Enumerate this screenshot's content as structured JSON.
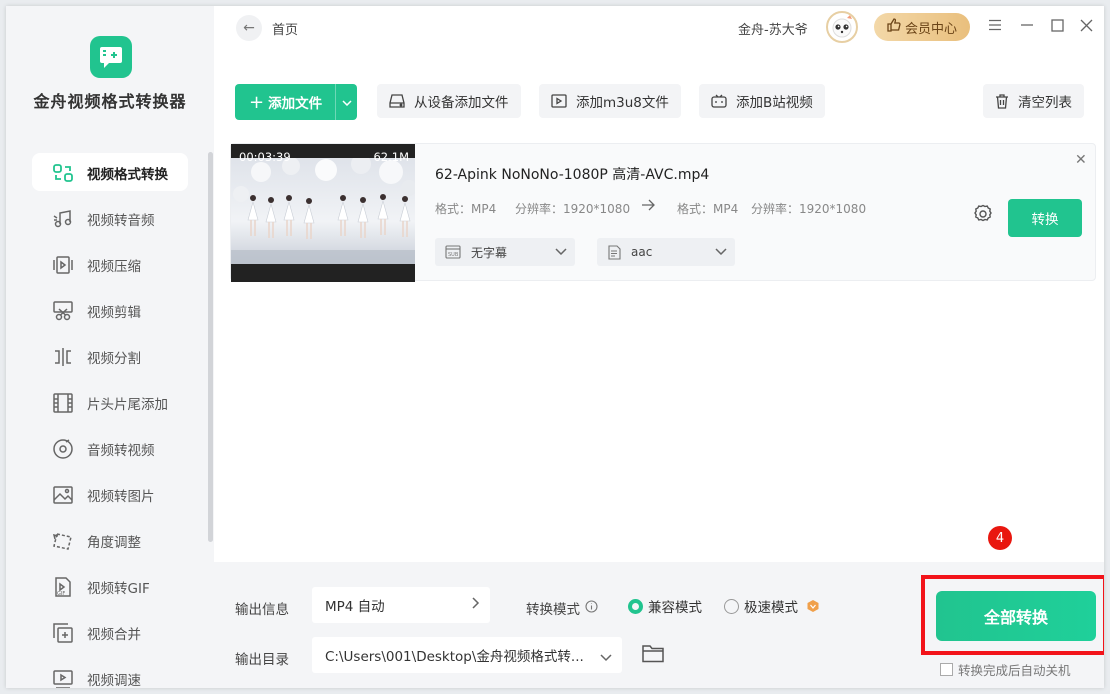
{
  "app": {
    "title": "金舟视频格式转换器"
  },
  "sidebar": {
    "items": [
      {
        "label": "视频格式转换",
        "icon": "format-convert-icon",
        "active": true
      },
      {
        "label": "视频转音频",
        "icon": "music-note-icon"
      },
      {
        "label": "视频压缩",
        "icon": "compress-icon"
      },
      {
        "label": "视频剪辑",
        "icon": "scissors-icon"
      },
      {
        "label": "视频分割",
        "icon": "split-icon"
      },
      {
        "label": "片头片尾添加",
        "icon": "film-strip-icon"
      },
      {
        "label": "音频转视频",
        "icon": "disc-icon"
      },
      {
        "label": "视频转图片",
        "icon": "image-icon"
      },
      {
        "label": "角度调整",
        "icon": "rotate-icon"
      },
      {
        "label": "视频转GIF",
        "icon": "gif-icon"
      },
      {
        "label": "视频合并",
        "icon": "merge-icon"
      },
      {
        "label": "视频调速",
        "icon": "speed-icon"
      }
    ]
  },
  "header": {
    "breadcrumb": "首页",
    "user_name": "金舟-苏大爷",
    "vip_label": "会员中心"
  },
  "toolbar": {
    "add_file": "添加文件",
    "add_from_device": "从设备添加文件",
    "add_m3u8": "添加m3u8文件",
    "add_bilibili": "添加B站视频",
    "clear_list": "清空列表"
  },
  "file": {
    "name": "62-Apink NoNoNo-1080P 高清-AVC.mp4",
    "duration": "00:03:39",
    "size": "62.1M",
    "src_format": "格式：MP4",
    "src_resolution": "分辨率：1920*1080",
    "dst_format": "格式：MP4",
    "dst_resolution": "分辨率：1920*1080",
    "subtitle": "无字幕",
    "audio": "aac",
    "convert_label": "转换"
  },
  "bottom": {
    "output_info_label": "输出信息",
    "output_info_value": "MP4 自动",
    "output_dir_label": "输出目录",
    "output_dir_value": "C:\\Users\\001\\Desktop\\金舟视频格式转...",
    "mode_label": "转换模式",
    "mode_compatible": "兼容模式",
    "mode_fast": "极速模式",
    "convert_all": "全部转换",
    "shutdown_label": "转换完成后自动关机",
    "step_badge": "4"
  },
  "colors": {
    "accent": "#21c48f",
    "highlight": "#f2131a",
    "vip": "#e9bf7d"
  }
}
